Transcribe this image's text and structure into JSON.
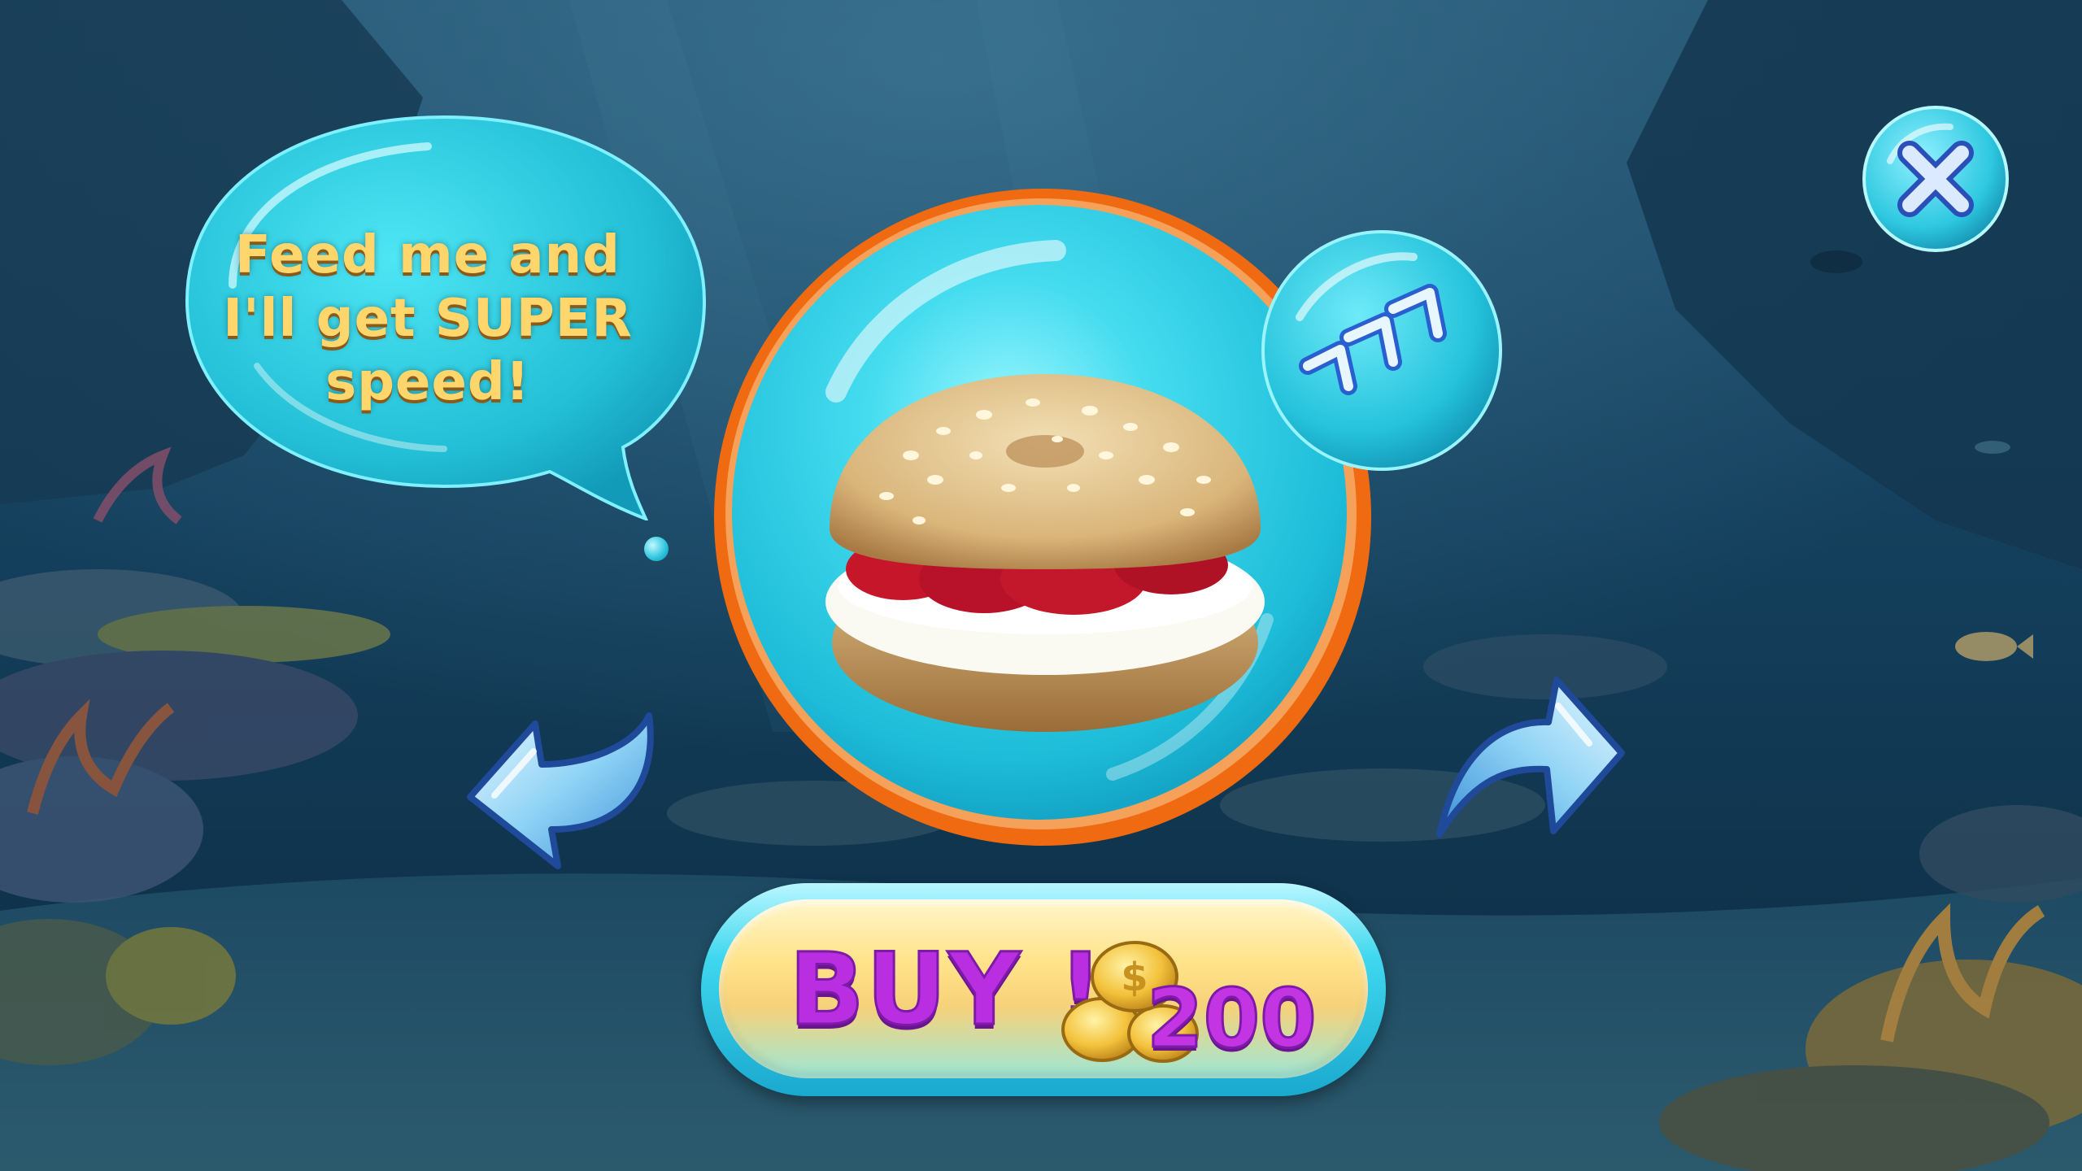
{
  "speech": {
    "text": "Feed me and I'll get SUPER speed!"
  },
  "product": {
    "image": "strawberry-cream-bagel",
    "speed_icon": "speed-up-chevrons-icon"
  },
  "close_icon": "close-icon",
  "nav": {
    "prev_icon": "back-arrow-icon",
    "next_icon": "forward-arrow-icon"
  },
  "buy": {
    "label": "BUY !",
    "price": "200",
    "currency_icon": "gold-coins-icon"
  },
  "colors": {
    "bubble": "#3fd7ee",
    "bubble_rim": "#f06a12",
    "buy_text": "#b92ee0",
    "speech_text": "#ffd66b"
  }
}
